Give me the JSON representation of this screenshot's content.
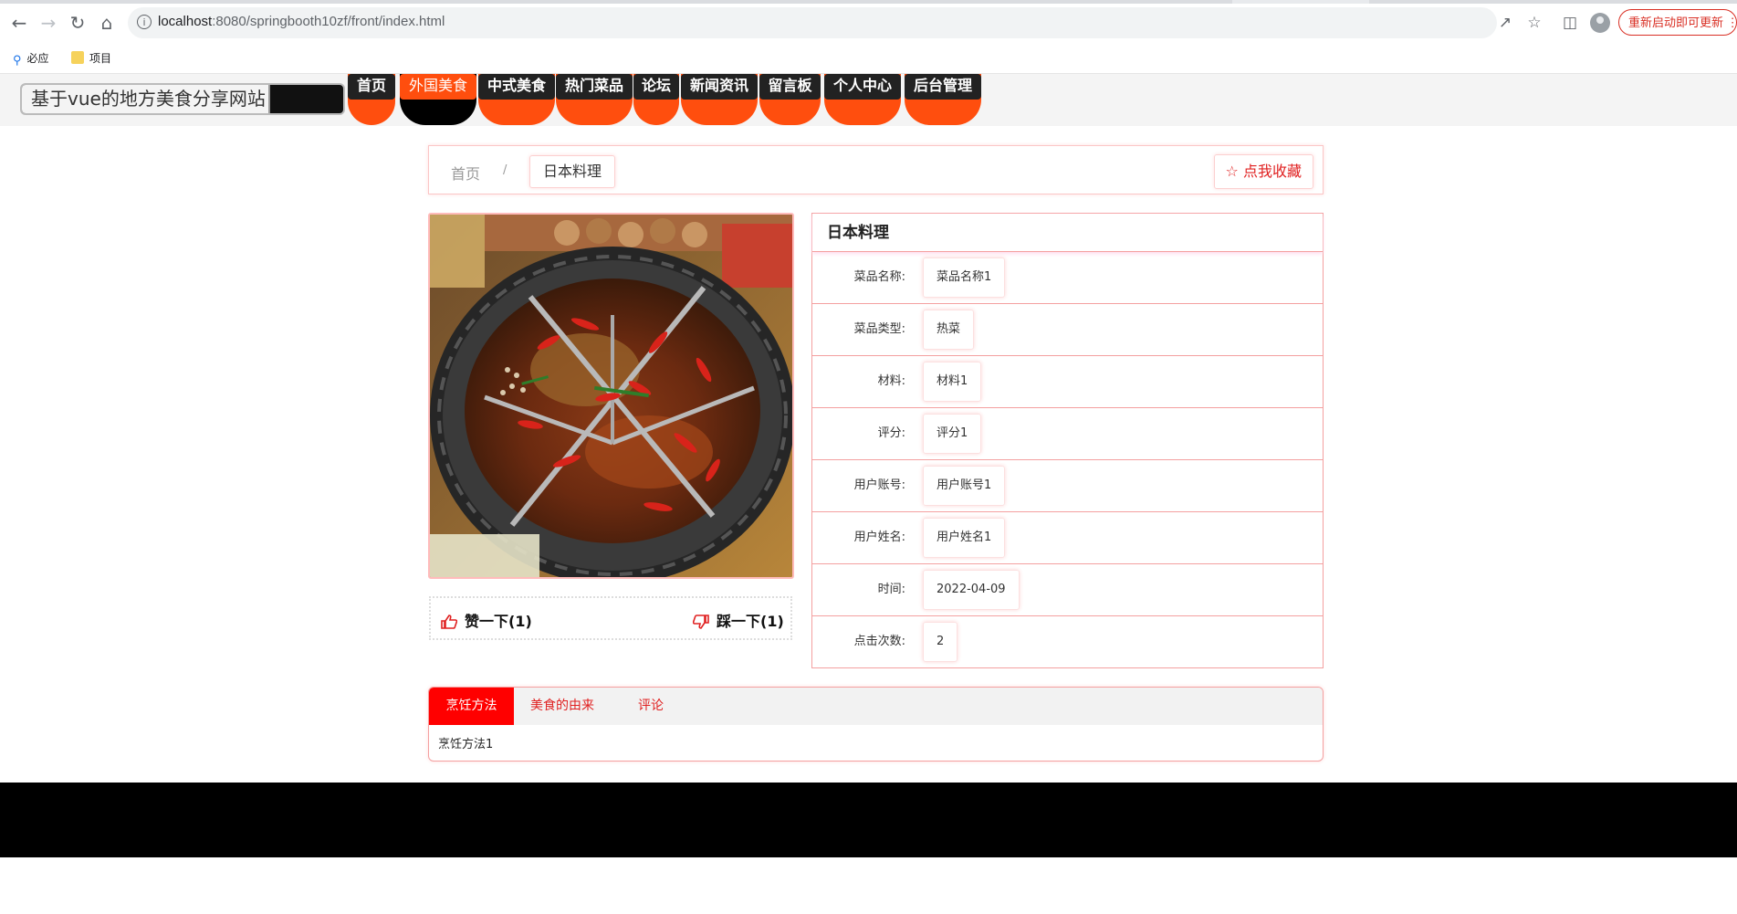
{
  "browser": {
    "url_host": "localhost",
    "url_path": ":8080/springbooth10zf/front/index.html",
    "update_button": "重新启动即可更新",
    "bookmarks": [
      {
        "label": "必应",
        "icon": "search-icon"
      },
      {
        "label": "项目",
        "icon": "folder-icon"
      }
    ]
  },
  "site": {
    "title": "基于vue的地方美食分享网站",
    "nav": [
      {
        "label": "首页"
      },
      {
        "label": "外国美食",
        "active": true
      },
      {
        "label": "中式美食"
      },
      {
        "label": "热门菜品"
      },
      {
        "label": "论坛"
      },
      {
        "label": "新闻资讯"
      },
      {
        "label": "留言板"
      },
      {
        "label": "个人中心"
      },
      {
        "label": "后台管理"
      }
    ],
    "accent": "#ff4e0e"
  },
  "breadcrumb": {
    "home": "首页",
    "separator": "/",
    "current": "日本料理",
    "favorite": "点我收藏"
  },
  "votes": {
    "like": "赞一下(1)",
    "dislike": "踩一下(1)"
  },
  "detail": {
    "title": "日本料理",
    "rows": [
      {
        "key": "菜品名称:",
        "value": "菜品名称1"
      },
      {
        "key": "菜品类型:",
        "value": "热菜"
      },
      {
        "key": "材料:",
        "value": "材料1"
      },
      {
        "key": "评分:",
        "value": "评分1"
      },
      {
        "key": "用户账号:",
        "value": "用户账号1"
      },
      {
        "key": "用户姓名:",
        "value": "用户姓名1"
      },
      {
        "key": "时间:",
        "value": "2022-04-09"
      },
      {
        "key": "点击次数:",
        "value": "2"
      }
    ]
  },
  "tabs": {
    "items": [
      {
        "label": "烹饪方法",
        "active": true
      },
      {
        "label": "美食的由来"
      },
      {
        "label": "评论"
      }
    ],
    "content": "烹饪方法1"
  },
  "colors": {
    "tab_active": "#ff0000",
    "link_red": "#e02020",
    "footer": "#000000"
  }
}
